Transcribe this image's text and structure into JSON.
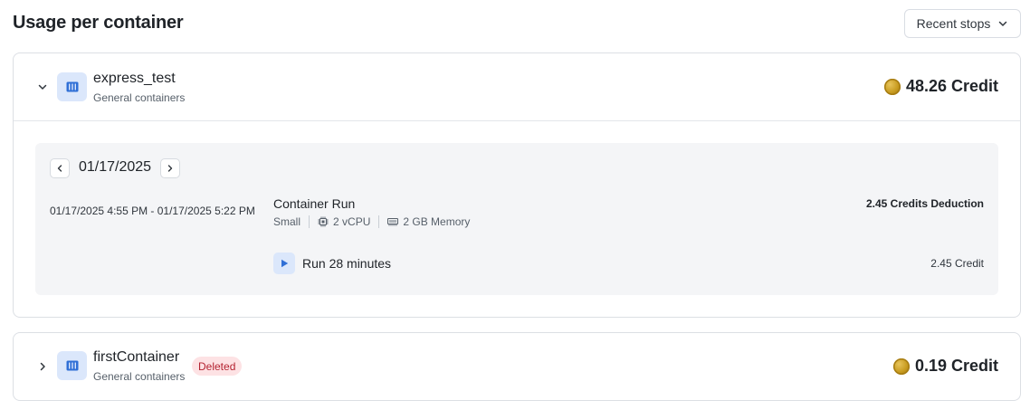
{
  "header": {
    "title": "Usage per container",
    "sort_label": "Recent stops"
  },
  "containers": [
    {
      "name": "express_test",
      "subtitle": "General containers",
      "total_credit": "48.26 Credit",
      "expanded": true,
      "detail": {
        "date": "01/17/2025",
        "entries": [
          {
            "time_range": "01/17/2025 4:55 PM - 01/17/2025 5:22 PM",
            "title": "Container Run",
            "size": "Small",
            "cpu": "2 vCPU",
            "memory": "2 GB Memory",
            "deduction": "2.45 Credits Deduction",
            "run_label": "Run 28 minutes",
            "run_credit": "2.45 Credit"
          }
        ]
      }
    },
    {
      "name": "firstContainer",
      "subtitle": "General containers",
      "badge": "Deleted",
      "total_credit": "0.19 Credit",
      "expanded": false
    }
  ],
  "colors": {
    "accent": "#2f6fd6",
    "icon_bg": "#dbe7fb",
    "deleted_bg": "#fde2e4",
    "deleted_text": "#b42331",
    "coin": "#c79a1e"
  },
  "icons": {
    "sort": "chevron-down-icon",
    "container": "container-icon",
    "coin": "coin-icon",
    "cpu": "cpu-icon",
    "memory": "memory-icon",
    "run": "play-icon"
  }
}
